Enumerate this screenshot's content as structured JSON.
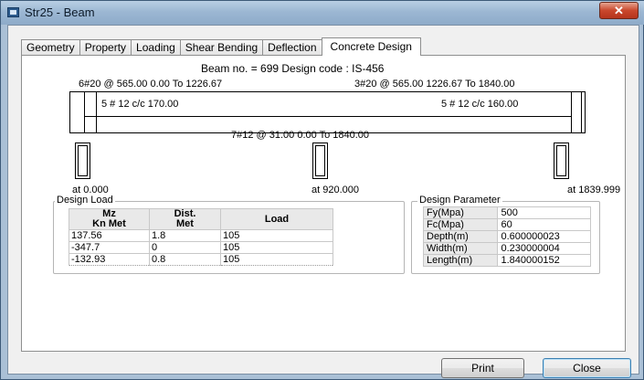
{
  "window": {
    "title": "Str25 - Beam",
    "close_glyph": "✕"
  },
  "tabs": [
    {
      "label": "Geometry"
    },
    {
      "label": "Property"
    },
    {
      "label": "Loading"
    },
    {
      "label": "Shear Bending"
    },
    {
      "label": "Deflection"
    },
    {
      "label": "Concrete Design",
      "active": true
    }
  ],
  "header": {
    "summary": "Beam no. = 699  Design code :  IS-456"
  },
  "beam_diagram": {
    "top_left_rebar": "6#20 @ 565.00 0.00 To 1226.67",
    "top_right_rebar": "3#20 @ 565.00 1226.67 To 1840.00",
    "stirrup_left": "5 # 12 c/c 170.00",
    "stirrup_right": "5 # 12 c/c 160.00",
    "bottom_rebar": "7#12 @ 31.00 0.00 To 1840.00",
    "support_left": "at 0.000",
    "support_mid": "at 920.000",
    "support_right": "at 1839.999"
  },
  "design_load": {
    "title": "Design Load",
    "headers": {
      "mz_1": "Mz",
      "mz_2": "Kn Met",
      "dist_1": "Dist.",
      "dist_2": "Met",
      "load": "Load"
    },
    "rows": [
      {
        "mz": "137.56",
        "dist": "1.8",
        "load": "105"
      },
      {
        "mz": "-347.7",
        "dist": "0",
        "load": "105"
      },
      {
        "mz": "-132.93",
        "dist": "0.8",
        "load": "105"
      }
    ]
  },
  "design_parameter": {
    "title": "Design Parameter",
    "rows": [
      {
        "label": "Fy(Mpa)",
        "value": "500"
      },
      {
        "label": "Fc(Mpa)",
        "value": "60"
      },
      {
        "label": "Depth(m)",
        "value": "0.600000023"
      },
      {
        "label": "Width(m)",
        "value": "0.230000004"
      },
      {
        "label": "Length(m)",
        "value": "1.840000152"
      }
    ]
  },
  "buttons": {
    "print": "Print",
    "close": "Close"
  },
  "colors": {
    "titlebar": "#9cb7d3",
    "close_button": "#c9472c",
    "default_button_border": "#3c7fb1"
  }
}
